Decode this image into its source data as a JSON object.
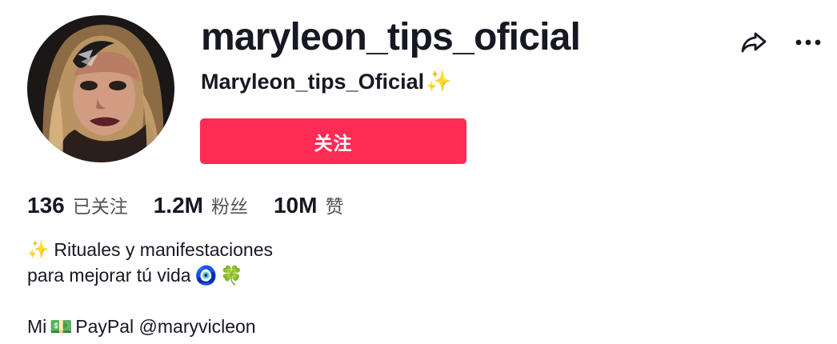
{
  "profile": {
    "username": "maryleon_tips_oficial",
    "display_name": "Maryleon_tips_Oficial",
    "display_name_emoji": "✨",
    "follow_label": "关注",
    "share_icon": "share-icon",
    "more_icon": "more-icon",
    "avatar_icon": "avatar"
  },
  "stats": [
    {
      "value": "136",
      "label": "已关注"
    },
    {
      "value": "1.2M",
      "label": "粉丝"
    },
    {
      "value": "10M",
      "label": "赞"
    }
  ],
  "bio": {
    "line1_emoji": "✨",
    "line1_text": "Rituales y manifestaciones",
    "line2_text": "para mejorar tú vida",
    "line2_emoji_1": "🧿",
    "line2_emoji_2": "🍀",
    "line4_text_before": "Mi",
    "line4_emoji": "💵",
    "line4_text_after": "PayPal @maryvicleon"
  },
  "colors": {
    "brand": "#fe2c55",
    "text": "#161823",
    "muted": "rgba(22, 24, 35, 0.75)",
    "sparkle": "#f4c542"
  }
}
